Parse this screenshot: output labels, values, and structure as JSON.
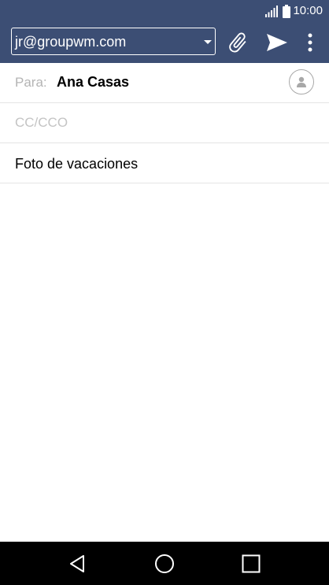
{
  "status_bar": {
    "time": "10:00",
    "signal_icon": "signal-icon",
    "battery_icon": "battery-icon"
  },
  "compose": {
    "from_account": "jr@groupwm.com",
    "toolbar": {
      "attach_icon": "paperclip-icon",
      "send_icon": "send-icon",
      "more_icon": "more-vertical-icon"
    },
    "to_label": "Para:",
    "to_recipient": "Ana Casas",
    "contact_picker_icon": "contact-icon",
    "cc_placeholder": "CC/CCO",
    "subject": "Foto de vacaciones",
    "body": ""
  },
  "nav_bar": {
    "back_icon": "back-icon",
    "home_icon": "home-icon",
    "recents_icon": "recents-icon"
  },
  "colors": {
    "app_bar": "#3c4e74",
    "nav_bar": "#000000",
    "divider": "#e4e4e4",
    "label_gray": "#b4b4b4"
  }
}
